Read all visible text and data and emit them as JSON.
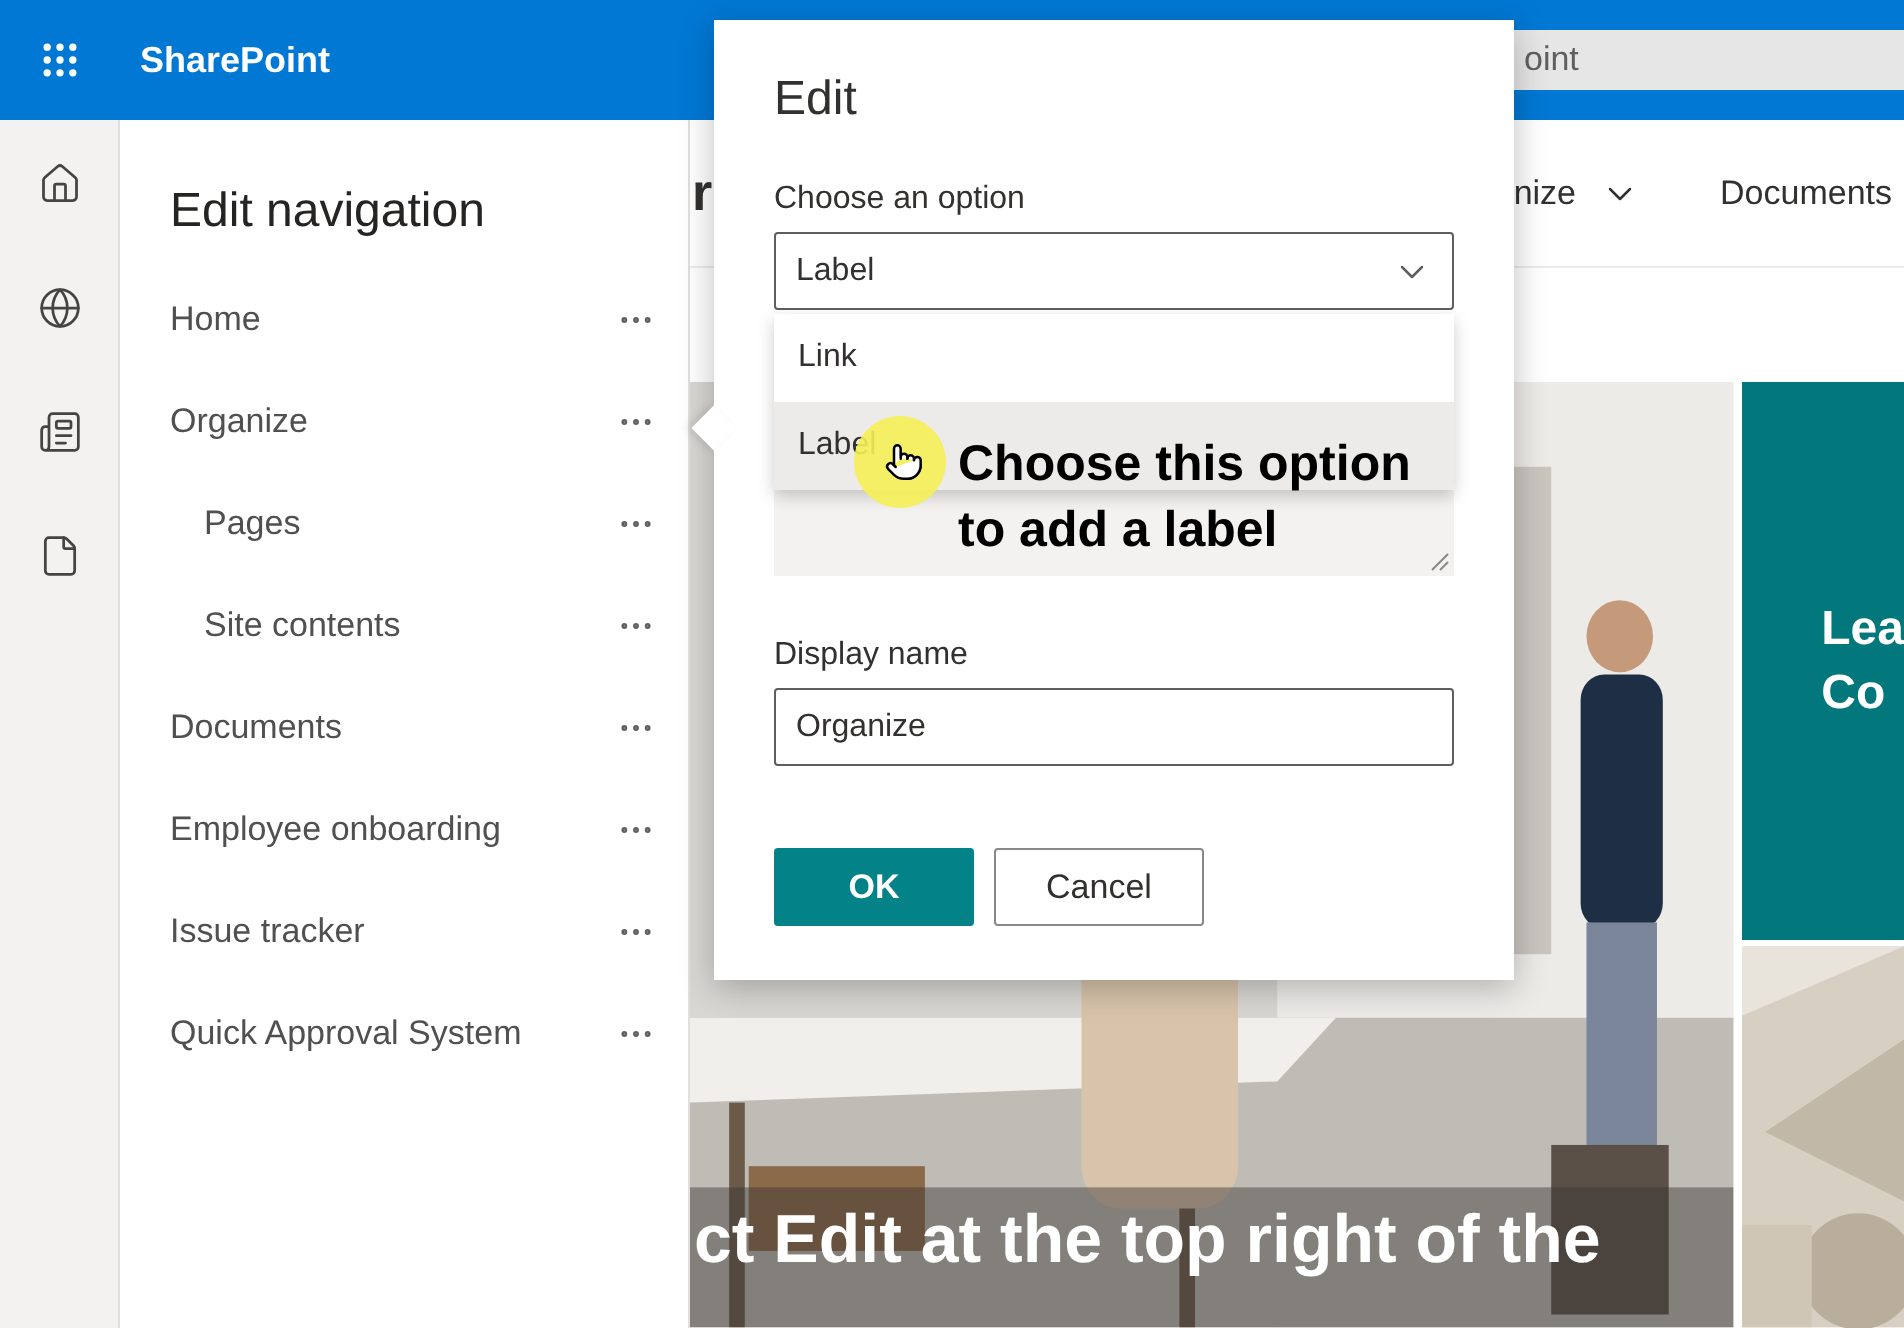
{
  "app": {
    "name": "SharePoint"
  },
  "search": {
    "value": "oint"
  },
  "nav_panel": {
    "title": "Edit navigation",
    "items": [
      {
        "label": "Home"
      },
      {
        "label": "Organize",
        "children": [
          {
            "label": "Pages"
          },
          {
            "label": "Site contents"
          }
        ]
      },
      {
        "label": "Documents"
      },
      {
        "label": "Employee onboarding"
      },
      {
        "label": "Issue tracker"
      },
      {
        "label": "Quick Approval System"
      }
    ]
  },
  "site_header": {
    "title_fragment": "r",
    "nav": [
      {
        "label": "nize",
        "has_dropdown": true
      },
      {
        "label": "Documents",
        "has_dropdown": false
      }
    ]
  },
  "hero": {
    "kind": "picture",
    "caption": "ct Edit at the top right of the"
  },
  "tile": {
    "lines": [
      "Lea",
      "Co"
    ]
  },
  "dialog": {
    "title": "Edit",
    "option_label": "Choose an option",
    "option_value": "Label",
    "options": [
      {
        "label": "Link",
        "selected": false
      },
      {
        "label": "Label",
        "selected": true
      }
    ],
    "display_name_label": "Display name",
    "display_name_value": "Organize",
    "buttons": [
      {
        "label": "OK",
        "kind": "primary"
      },
      {
        "label": "Cancel",
        "kind": "default"
      }
    ]
  },
  "annotation": {
    "lines": [
      "Choose this option",
      "to add a label"
    ]
  }
}
